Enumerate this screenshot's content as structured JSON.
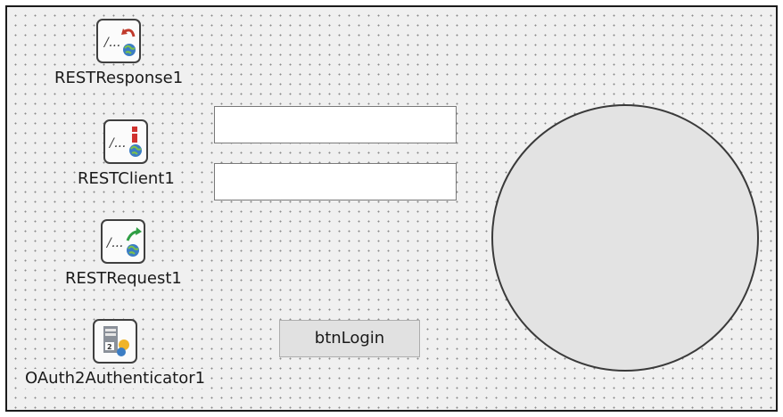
{
  "components": [
    {
      "name": "RESTResponse1",
      "icon": "rest-response-icon"
    },
    {
      "name": "RESTClient1",
      "icon": "rest-client-icon"
    },
    {
      "name": "RESTRequest1",
      "icon": "rest-request-icon"
    },
    {
      "name": "OAuth2Authenticator1",
      "icon": "oauth2-authenticator-icon"
    }
  ],
  "edit1": {
    "value": "",
    "placeholder": ""
  },
  "edit2": {
    "value": "",
    "placeholder": ""
  },
  "login_button": {
    "label": "btnLogin"
  },
  "circle": {
    "fill": "#e3e3e3",
    "stroke": "#3a3a3a"
  },
  "colors": {
    "form_background": "#f0f0f0",
    "grid_dot": "#8a8a8a"
  }
}
